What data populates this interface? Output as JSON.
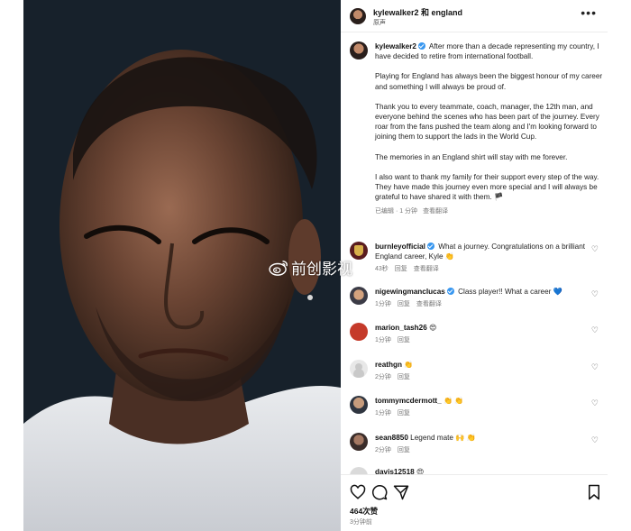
{
  "header": {
    "username": "kylewalker2 和 england",
    "subtitle": "原声",
    "more": "•••"
  },
  "caption": {
    "username": "kylewalker2",
    "paragraphs": [
      "After more than a decade representing my country, I have decided to retire from international football.",
      "Playing for England has always been the biggest honour of my career and something I will always be proud of.",
      "Thank you to every teammate, coach, manager, the 12th man, and everyone behind the scenes who has been part of the journey. Every roar from the fans pushed the team along and I'm looking forward to joining them to support the lads in the World Cup.",
      "The memories in an England shirt will stay with me forever.",
      "I also want to thank my family for their support every step of the way. They have made this journey even more special and I will always be grateful to have shared it with them. 🏴"
    ],
    "edited": "已编辑 · 1 分钟",
    "translate": "查看翻译"
  },
  "comments": [
    {
      "username": "burnleyofficial",
      "verified": true,
      "text": "What a journey. Congratulations on a brilliant England career, Kyle 👏",
      "time": "43秒",
      "reply": "回复",
      "translate": "查看翻译"
    },
    {
      "username": "nigewingmanclucas",
      "verified": true,
      "text": "Class player!! What a career 💙",
      "time": "1分钟",
      "reply": "回复",
      "translate": "查看翻译"
    },
    {
      "username": "marion_tash26",
      "verified": false,
      "text": "😍",
      "time": "1分钟",
      "reply": "回复",
      "translate": ""
    },
    {
      "username": "reathgn",
      "verified": false,
      "text": "👏",
      "time": "2分钟",
      "reply": "回复",
      "translate": ""
    },
    {
      "username": "tommymcdermott_",
      "verified": false,
      "text": "👏 👏",
      "time": "1分钟",
      "reply": "回复",
      "translate": ""
    },
    {
      "username": "sean8850",
      "verified": false,
      "text": "Legend mate 🙌 👏",
      "time": "2分钟",
      "reply": "回复",
      "translate": ""
    },
    {
      "username": "davis12518",
      "verified": false,
      "text": "😍",
      "time": "",
      "reply": "",
      "translate": ""
    }
  ],
  "footer": {
    "likes": "464次赞",
    "time": "3分钟前"
  },
  "watermark": {
    "text": "前创影视"
  },
  "colors": {
    "verified": "#3897f0",
    "text": "#111111",
    "meta": "#777777"
  },
  "icons": [
    "heart-icon",
    "comment-icon",
    "share-icon",
    "bookmark-icon",
    "more-icon",
    "weibo-logo"
  ]
}
